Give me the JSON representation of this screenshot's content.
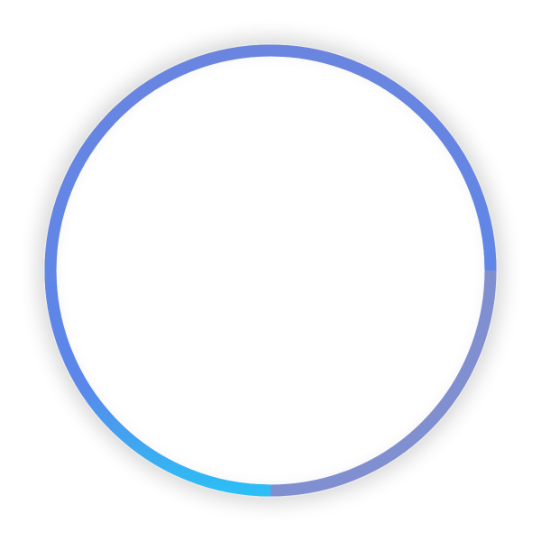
{
  "progress_ring": {
    "progress": 0.75,
    "colors": {
      "track": "#7f8fcf",
      "progress_start": "#29c1f6",
      "progress_mid": "#5b86ea",
      "progress_end": "#6a85e0",
      "background": "#ffffff"
    }
  }
}
